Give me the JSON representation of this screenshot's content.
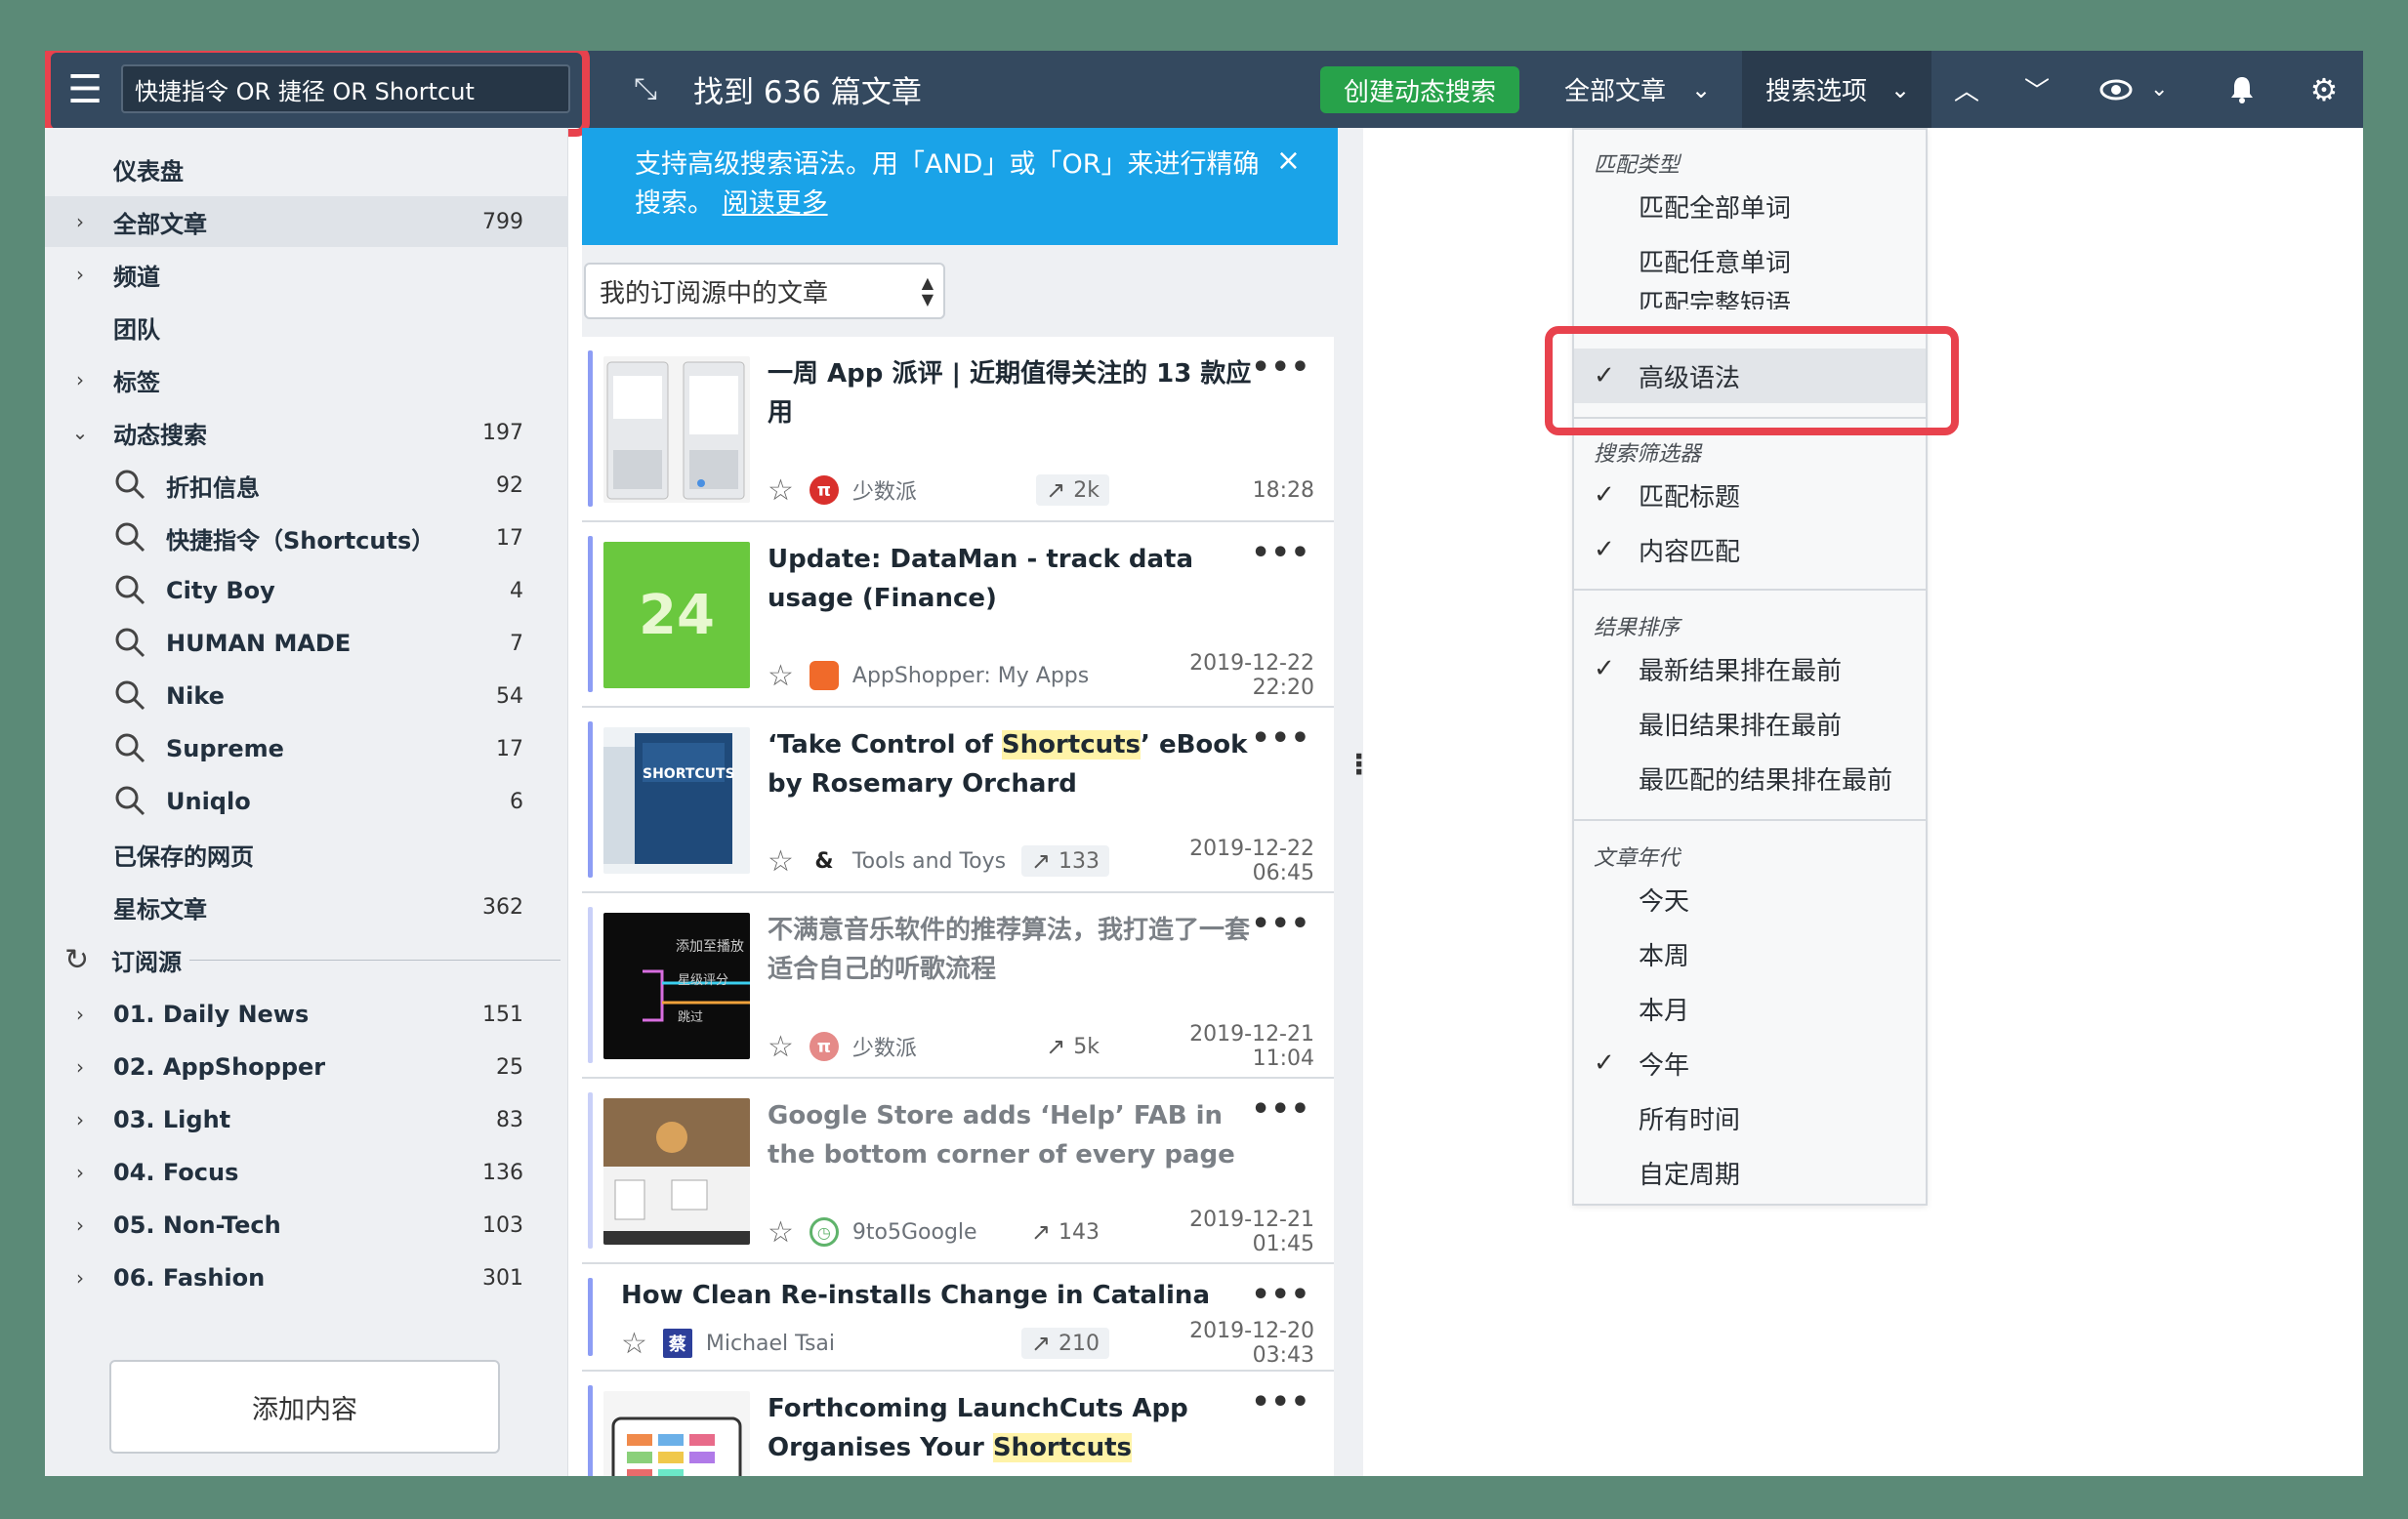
{
  "topbar": {
    "search_value": "快捷指令 OR 捷径 OR Shortcut",
    "found_title": "找到 636 篇文章",
    "create_dynamic_search": "创建动态搜索",
    "all_articles": "全部文章",
    "search_options": "搜索选项"
  },
  "sidebar": {
    "dashboard": "仪表盘",
    "all_articles": {
      "label": "全部文章",
      "count": "799"
    },
    "channels": "频道",
    "teams": "团队",
    "tags": "标签",
    "dynamic_search": {
      "label": "动态搜索",
      "count": "197"
    },
    "searches": [
      {
        "label": "折扣信息",
        "count": "92"
      },
      {
        "label": "快捷指令（Shortcuts）",
        "count": "17"
      },
      {
        "label": "City Boy",
        "count": "4"
      },
      {
        "label": "HUMAN MADE",
        "count": "7"
      },
      {
        "label": "Nike",
        "count": "54"
      },
      {
        "label": "Supreme",
        "count": "17"
      },
      {
        "label": "Uniqlo",
        "count": "6"
      }
    ],
    "saved_pages": "已保存的网页",
    "starred": {
      "label": "星标文章",
      "count": "362"
    },
    "feeds_header": "订阅源",
    "feeds": [
      {
        "label": "01. Daily News",
        "count": "151"
      },
      {
        "label": "02. AppShopper",
        "count": "25"
      },
      {
        "label": "03. Light",
        "count": "83"
      },
      {
        "label": "04. Focus",
        "count": "136"
      },
      {
        "label": "05. Non-Tech",
        "count": "103"
      },
      {
        "label": "06. Fashion",
        "count": "301"
      }
    ],
    "add_content": "添加内容"
  },
  "banner": {
    "text": "支持高级搜索语法。用「AND」或「OR」来进行精确搜索。",
    "link": "阅读更多",
    "close": "×"
  },
  "source_select": {
    "value": "我的订阅源中的文章"
  },
  "articles": [
    {
      "title": "一周 App 派评 | 近期值得关注的 13 款应用",
      "source": "少数派",
      "trend": "2k",
      "time": "18:28"
    },
    {
      "title": "Update: DataMan - track data usage (Finance)",
      "source": "AppShopper: My Apps",
      "trend": "",
      "time": "2019-12-22 22:20",
      "thumb_text": "24"
    },
    {
      "title_pre": "‘Take Control of ",
      "title_hl": "Shortcuts",
      "title_post": "’ eBook by Rosemary Orchard",
      "source": "Tools and Toys",
      "trend": "133",
      "time": "2019-12-22 06:45",
      "thumb_text": "SHORTCUTS"
    },
    {
      "title": "不满意音乐软件的推荐算法，我打造了一套适合自己的听歌流程",
      "source": "少数派",
      "trend": "5k",
      "time": "2019-12-21 11:04",
      "thumb_lines": [
        "添加至播放",
        "星级评分",
        "跳过"
      ]
    },
    {
      "title": "Google Store adds ‘Help’ FAB in the bottom corner of every page",
      "source": "9to5Google",
      "trend": "143",
      "time": "2019-12-21 01:45"
    },
    {
      "title": "How Clean Re-installs Change in Catalina",
      "source": "Michael Tsai",
      "trend": "210",
      "time": "2019-12-20 03:43"
    },
    {
      "title_pre": "Forthcoming LaunchCuts App Organises Your ",
      "title_hl": "Shortcuts",
      "title_post": ""
    }
  ],
  "dropdown": {
    "match_type_header": "匹配类型",
    "match_all": "匹配全部单词",
    "match_any": "匹配任意单词",
    "match_phrase": "匹配完整短语",
    "advanced": "高级语法",
    "filter_header": "搜索筛选器",
    "match_title": "匹配标题",
    "match_content": "内容匹配",
    "sort_header": "结果排序",
    "newest": "最新结果排在最前",
    "oldest": "最旧结果排在最前",
    "best": "最匹配的结果排在最前",
    "age_header": "文章年代",
    "today": "今天",
    "week": "本周",
    "month": "本月",
    "year": "今年",
    "all_time": "所有时间",
    "custom": "自定周期"
  },
  "colors": {
    "topbar": "#34495f",
    "banner": "#1aa3e8",
    "create_button": "#27a24a",
    "highlight_border": "#e8424d",
    "unread_accent": "#8d9df5"
  }
}
